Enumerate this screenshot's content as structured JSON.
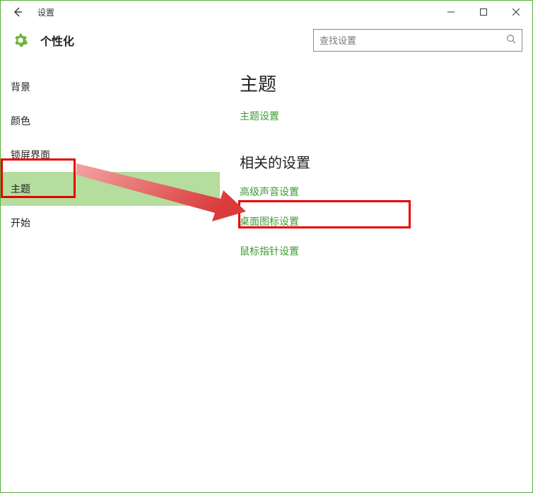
{
  "window": {
    "title": "设置"
  },
  "header": {
    "section": "个性化",
    "search_placeholder": "查找设置"
  },
  "sidebar": {
    "items": [
      {
        "label": "背景",
        "selected": false
      },
      {
        "label": "颜色",
        "selected": false
      },
      {
        "label": "锁屏界面",
        "selected": false
      },
      {
        "label": "主题",
        "selected": true
      },
      {
        "label": "开始",
        "selected": false
      }
    ]
  },
  "main": {
    "heading1": "主题",
    "link_theme_settings": "主题设置",
    "heading2": "相关的设置",
    "links_related": [
      "高级声音设置",
      "桌面图标设置",
      "鼠标指针设置"
    ]
  },
  "annotation": {
    "accent_color": "#e60000",
    "highlight_items": [
      "主题",
      "桌面图标设置"
    ]
  }
}
